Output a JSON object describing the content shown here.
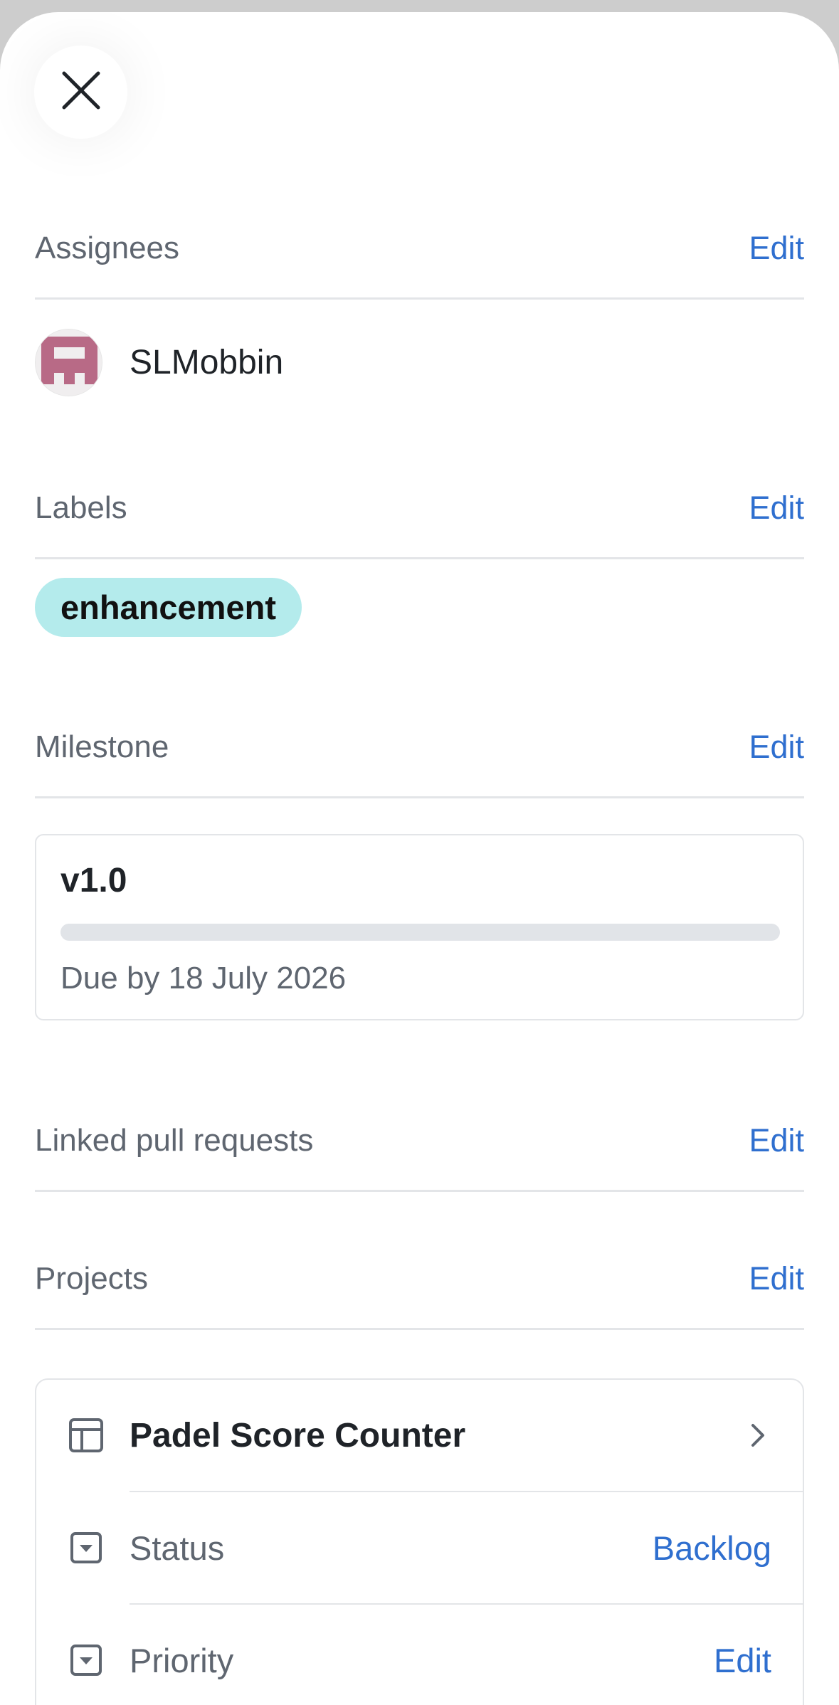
{
  "sheet": {
    "close_icon": "close-icon"
  },
  "assignees": {
    "title": "Assignees",
    "edit_label": "Edit",
    "people": [
      {
        "name": "SLMobbin",
        "avatar": "identicon-avatar",
        "avatar_color": "#b86a86"
      }
    ]
  },
  "labels": {
    "title": "Labels",
    "edit_label": "Edit",
    "items": [
      {
        "name": "enhancement",
        "color": "#b4ebec"
      }
    ]
  },
  "milestone": {
    "title": "Milestone",
    "edit_label": "Edit",
    "name": "v1.0",
    "progress": 0,
    "due_text": "Due by 18 July 2026"
  },
  "linked_pull_requests": {
    "title": "Linked pull requests",
    "edit_label": "Edit"
  },
  "projects": {
    "title": "Projects",
    "edit_label": "Edit",
    "project": {
      "name": "Padel Score Counter",
      "icon": "table-icon",
      "fields": [
        {
          "label": "Status",
          "value": "Backlog",
          "icon": "dropdown-field-icon"
        },
        {
          "label": "Priority",
          "value": "Edit",
          "icon": "dropdown-field-icon"
        }
      ]
    }
  },
  "colors": {
    "link": "#2f6fcf",
    "muted_text": "#5f6670",
    "primary_text": "#1f2328",
    "divider": "#e3e5e8",
    "label_chip": "#b4ebec"
  }
}
